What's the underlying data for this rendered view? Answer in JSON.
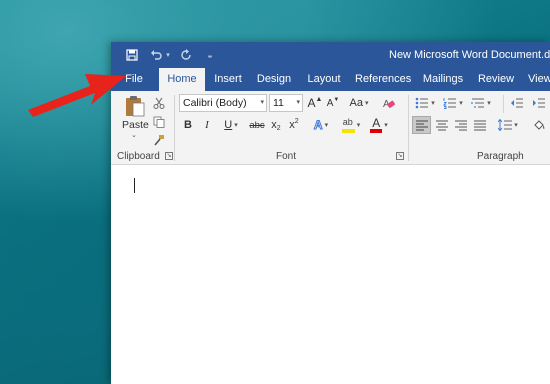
{
  "window": {
    "title": "New Microsoft Word Document.docx"
  },
  "tabs": [
    "File",
    "Home",
    "Insert",
    "Design",
    "Layout",
    "References",
    "Mailings",
    "Review",
    "View"
  ],
  "active_tab": "Home",
  "clipboard": {
    "paste_label": "Paste",
    "group_label": "Clipboard"
  },
  "font": {
    "name": "Calibri (Body)",
    "size": "11",
    "grow": "A",
    "shrink": "A",
    "change_case": "Aa",
    "bold": "B",
    "italic": "I",
    "underline": "U",
    "strikethrough": "abc",
    "subscript": "x",
    "superscript": "x",
    "text_effects": "A",
    "font_color": "A",
    "group_label": "Font"
  },
  "paragraph": {
    "group_label": "Paragraph"
  },
  "colors": {
    "word_blue": "#2b579a",
    "ribbon_bg": "#f3f3f3",
    "highlight": "#f5e400",
    "font_color_bar": "#e00000",
    "arrow_red": "#e8231b"
  }
}
